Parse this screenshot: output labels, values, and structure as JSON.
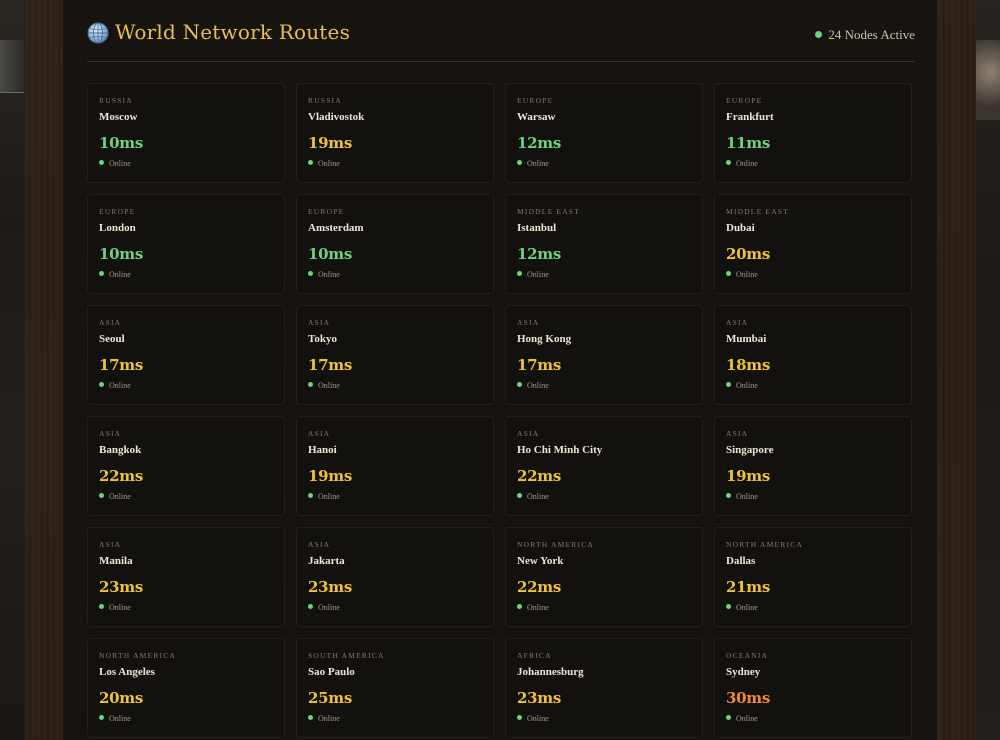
{
  "header": {
    "title": "World Network Routes",
    "globe_icon": "globe-icon",
    "nodes_active": "24 Nodes Active",
    "status_color": "#6fd27d",
    "title_color": "#e9bf52"
  },
  "colors": {
    "green": "#6fd27d",
    "yellow": "#f0c23a",
    "orange": "#ef8a3b"
  },
  "routes": [
    {
      "region": "RUSSIA",
      "city": "Moscow",
      "latency": "10ms",
      "level": "green",
      "status": "Online"
    },
    {
      "region": "RUSSIA",
      "city": "Vladivostok",
      "latency": "19ms",
      "level": "yellow",
      "status": "Online"
    },
    {
      "region": "EUROPE",
      "city": "Warsaw",
      "latency": "12ms",
      "level": "green",
      "status": "Online"
    },
    {
      "region": "EUROPE",
      "city": "Frankfurt",
      "latency": "11ms",
      "level": "green",
      "status": "Online"
    },
    {
      "region": "EUROPE",
      "city": "London",
      "latency": "10ms",
      "level": "green",
      "status": "Online"
    },
    {
      "region": "EUROPE",
      "city": "Amsterdam",
      "latency": "10ms",
      "level": "green",
      "status": "Online"
    },
    {
      "region": "MIDDLE EAST",
      "city": "Istanbul",
      "latency": "12ms",
      "level": "green",
      "status": "Online"
    },
    {
      "region": "MIDDLE EAST",
      "city": "Dubai",
      "latency": "20ms",
      "level": "yellow",
      "status": "Online"
    },
    {
      "region": "ASIA",
      "city": "Seoul",
      "latency": "17ms",
      "level": "yellow",
      "status": "Online"
    },
    {
      "region": "ASIA",
      "city": "Tokyo",
      "latency": "17ms",
      "level": "yellow",
      "status": "Online"
    },
    {
      "region": "ASIA",
      "city": "Hong Kong",
      "latency": "17ms",
      "level": "yellow",
      "status": "Online"
    },
    {
      "region": "ASIA",
      "city": "Mumbai",
      "latency": "18ms",
      "level": "yellow",
      "status": "Online"
    },
    {
      "region": "ASIA",
      "city": "Bangkok",
      "latency": "22ms",
      "level": "yellow",
      "status": "Online"
    },
    {
      "region": "ASIA",
      "city": "Hanoi",
      "latency": "19ms",
      "level": "yellow",
      "status": "Online"
    },
    {
      "region": "ASIA",
      "city": "Ho Chi Minh City",
      "latency": "22ms",
      "level": "yellow",
      "status": "Online"
    },
    {
      "region": "ASIA",
      "city": "Singapore",
      "latency": "19ms",
      "level": "yellow",
      "status": "Online"
    },
    {
      "region": "ASIA",
      "city": "Manila",
      "latency": "23ms",
      "level": "yellow",
      "status": "Online"
    },
    {
      "region": "ASIA",
      "city": "Jakarta",
      "latency": "23ms",
      "level": "yellow",
      "status": "Online"
    },
    {
      "region": "NORTH AMERICA",
      "city": "New York",
      "latency": "22ms",
      "level": "yellow",
      "status": "Online"
    },
    {
      "region": "NORTH AMERICA",
      "city": "Dallas",
      "latency": "21ms",
      "level": "yellow",
      "status": "Online"
    },
    {
      "region": "NORTH AMERICA",
      "city": "Los Angeles",
      "latency": "20ms",
      "level": "yellow",
      "status": "Online"
    },
    {
      "region": "SOUTH AMERICA",
      "city": "Sao Paulo",
      "latency": "25ms",
      "level": "yellow",
      "status": "Online"
    },
    {
      "region": "AFRICA",
      "city": "Johannesburg",
      "latency": "23ms",
      "level": "yellow",
      "status": "Online"
    },
    {
      "region": "OCEANIA",
      "city": "Sydney",
      "latency": "30ms",
      "level": "orange",
      "status": "Online"
    }
  ]
}
